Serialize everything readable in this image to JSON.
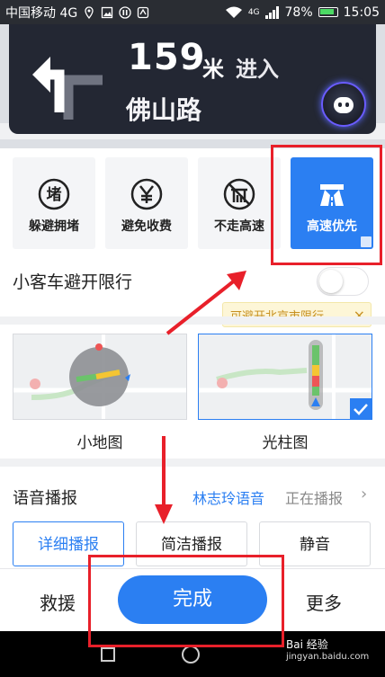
{
  "status_bar": {
    "carrier": "中国移动 4G",
    "signal_label": "4G",
    "battery": "78%",
    "time": "15:05"
  },
  "navigation": {
    "distance": "159",
    "unit": "米",
    "action": "进入",
    "road": "佛山路"
  },
  "route_prefs": [
    {
      "label": "躲避拥堵",
      "icon": "congestion-icon",
      "active": false
    },
    {
      "label": "避免收费",
      "icon": "yen-icon",
      "active": false
    },
    {
      "label": "不走高速",
      "icon": "no-highway-icon",
      "active": false
    },
    {
      "label": "高速优先",
      "icon": "highway-icon",
      "active": true
    }
  ],
  "restriction": {
    "label": "小客车避开限行",
    "tip": "可避开北京市限行",
    "tip_close": "×",
    "enabled": false
  },
  "map_views": [
    {
      "label": "小地图",
      "selected": false
    },
    {
      "label": "光柱图",
      "selected": true
    }
  ],
  "voice": {
    "label": "语音播报",
    "voice_name": "林志玲语音",
    "status": "正在播报",
    "chevron": "›"
  },
  "voice_modes": [
    {
      "label": "详细播报",
      "active": true
    },
    {
      "label": "简洁播报",
      "active": false
    },
    {
      "label": "静音",
      "active": false
    }
  ],
  "bottom": {
    "left": "救援",
    "done": "完成",
    "right": "更多"
  },
  "watermark": {
    "text": "Bai 经验",
    "sub": "jingyan.baidu.com"
  },
  "colors": {
    "accent": "#2b7ff2",
    "nav_bg": "#232733",
    "annotation": "#e8202a",
    "tip_bg": "#fdf6d7"
  }
}
